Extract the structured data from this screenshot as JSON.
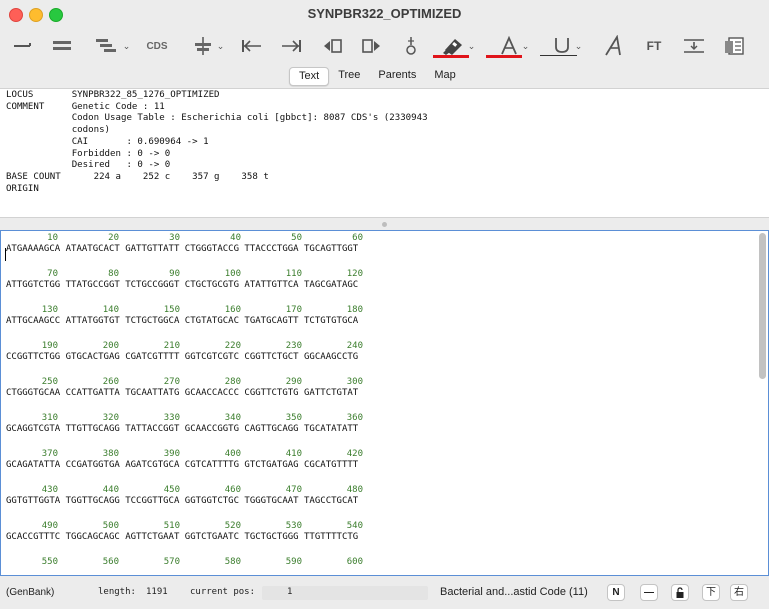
{
  "window": {
    "title": "SYNPBR322_OPTIMIZED"
  },
  "toolbar": {
    "cds_label": "CDS",
    "ft_label": "FT",
    "icons": [
      "open-ends-icon",
      "duplicate-strands-icon",
      "strand-layout-icon",
      "cds-icon",
      "selection-tool-icon",
      "go-start-icon",
      "go-end-icon",
      "page-previous-icon",
      "page-next-icon",
      "cut-site-icon",
      "highlighter-icon",
      "text-color-icon",
      "underline-icon",
      "italic-font-icon",
      "ft-icon",
      "insert-icon",
      "properties-icon"
    ],
    "accent": "#e0141a"
  },
  "tabs": [
    "Text",
    "Tree",
    "Parents",
    "Map"
  ],
  "active_tab": "Text",
  "header": {
    "lines": [
      "LOCUS       SYNPBR322_85_1276_OPTIMIZED",
      "COMMENT     Genetic Code : 11",
      "            Codon Usage Table : Escherichia coli [gbbct]: 8087 CDS's (2330943",
      "            codons)",
      "            CAI       : 0.690964 -> 1",
      "            Forbidden : 0 -> 0",
      "            Desired   : 0 -> 0",
      "BASE COUNT      224 a    252 c    357 g    358 t",
      "ORIGIN"
    ]
  },
  "sequence": {
    "number_color": "#3a7d2c",
    "rows": [
      {
        "nums": [
          "10",
          "20",
          "30",
          "40",
          "50",
          "60"
        ],
        "seq": "ATGAAAAGCA ATAATGCACT GATTGTTATT CTGGGTACCG TTACCCTGGA TGCAGTTGGT"
      },
      {
        "nums": [
          "70",
          "80",
          "90",
          "100",
          "110",
          "120"
        ],
        "seq": "ATTGGTCTGG TTATGCCGGT TCTGCCGGGT CTGCTGCGTG ATATTGTTCA TAGCGATAGC"
      },
      {
        "nums": [
          "130",
          "140",
          "150",
          "160",
          "170",
          "180"
        ],
        "seq": "ATTGCAAGCC ATTATGGTGT TCTGCTGGCA CTGTATGCAC TGATGCAGTT TCTGTGTGCA"
      },
      {
        "nums": [
          "190",
          "200",
          "210",
          "220",
          "230",
          "240"
        ],
        "seq": "CCGGTTCTGG GTGCACTGAG CGATCGTTTT GGTCGTCGTC CGGTTCTGCT GGCAAGCCTG"
      },
      {
        "nums": [
          "250",
          "260",
          "270",
          "280",
          "290",
          "300"
        ],
        "seq": "CTGGGTGCAA CCATTGATTA TGCAATTATG GCAACCACCC CGGTTCTGTG GATTCTGTAT"
      },
      {
        "nums": [
          "310",
          "320",
          "330",
          "340",
          "350",
          "360"
        ],
        "seq": "GCAGGTCGTA TTGTTGCAGG TATTACCGGT GCAACCGGTG CAGTTGCAGG TGCATATATT"
      },
      {
        "nums": [
          "370",
          "380",
          "390",
          "400",
          "410",
          "420"
        ],
        "seq": "GCAGATATTA CCGATGGTGA AGATCGTGCA CGTCATTTTG GTCTGATGAG CGCATGTTTT"
      },
      {
        "nums": [
          "430",
          "440",
          "450",
          "460",
          "470",
          "480"
        ],
        "seq": "GGTGTTGGTA TGGTTGCAGG TCCGGTTGCA GGTGGTCTGC TGGGTGCAAT TAGCCTGCAT"
      },
      {
        "nums": [
          "490",
          "500",
          "510",
          "520",
          "530",
          "540"
        ],
        "seq": "GCACCGTTTC TGGCAGCAGC AGTTCTGAAT GGTCTGAATC TGCTGCTGGG TTGTTTTCTG"
      },
      {
        "nums": [
          "550",
          "560",
          "570",
          "580",
          "590",
          "600"
        ],
        "seq": ""
      }
    ]
  },
  "statusbar": {
    "format": "(GenBank)",
    "length_label": "length:",
    "length_value": "1191",
    "pos_label": "current pos:",
    "pos_value": "1",
    "genetic_code": "Bacterial and...astid Code (11)",
    "btn_n": "N",
    "btn_dash": "—",
    "btn_lock_icon": "lock-icon",
    "btn_down": "下",
    "btn_right": "右"
  }
}
